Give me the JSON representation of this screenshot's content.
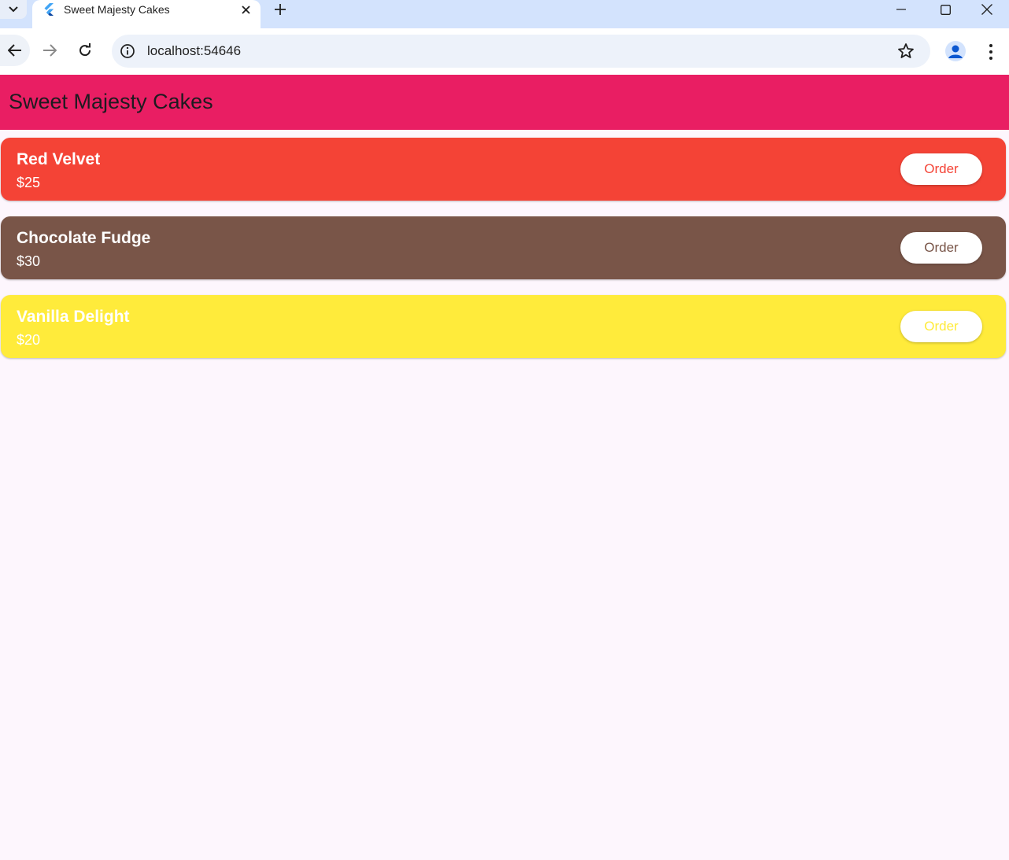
{
  "browser": {
    "tab_title": "Sweet Majesty Cakes",
    "url": "localhost:54646"
  },
  "app": {
    "title": "Sweet Majesty Cakes",
    "appbar_color": "#e91e63",
    "background_color": "#fdf6fd"
  },
  "cakes": [
    {
      "name": "Red Velvet",
      "price": "$25",
      "color": "#f44336",
      "order_label": "Order"
    },
    {
      "name": "Chocolate Fudge",
      "price": "$30",
      "color": "#795548",
      "order_label": "Order"
    },
    {
      "name": "Vanilla Delight",
      "price": "$20",
      "color": "#ffeb3b",
      "order_label": "Order"
    }
  ]
}
